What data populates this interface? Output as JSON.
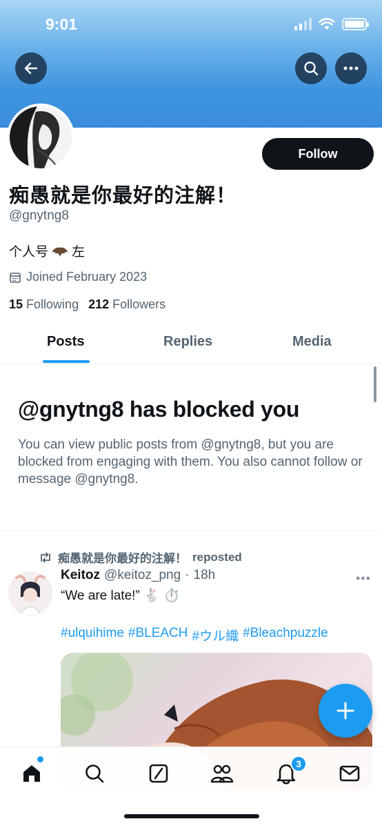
{
  "status_bar": {
    "time": "9:01"
  },
  "profile": {
    "display_name": "痴愚就是你最好的注解！",
    "handle": "@gnytng8",
    "bio_text": "个人号",
    "bio_suffix": "左",
    "joined": "Joined February 2023",
    "following_count": "15",
    "following_label": "Following",
    "followers_count": "212",
    "followers_label": "Followers",
    "follow_label": "Follow"
  },
  "tabs": [
    {
      "label": "Posts",
      "active": true
    },
    {
      "label": "Replies",
      "active": false
    },
    {
      "label": "Media",
      "active": false
    }
  ],
  "blocked_notice": {
    "title": "@gnytng8 has blocked you",
    "body": "You can view public posts from @gnytng8, but you are blocked from engaging with them. You also cannot follow or message @gnytng8."
  },
  "tweet": {
    "repost_by": "痴愚就是你最好的注解！",
    "repost_suffix": "reposted",
    "author_name": "Keitoz",
    "author_handle": "@keitoz_png",
    "time": "18h",
    "text": "“We are late!” 🐇 ⏱️",
    "hashtags": [
      "#ulquihime",
      "#BLEACH",
      "#ウル織",
      "#Bleachpuzzle"
    ]
  },
  "bottom_nav": {
    "notifications_badge": "3"
  },
  "colors": {
    "accent": "#1d9bf0",
    "text_primary": "#0f1419",
    "text_secondary": "#536471"
  }
}
